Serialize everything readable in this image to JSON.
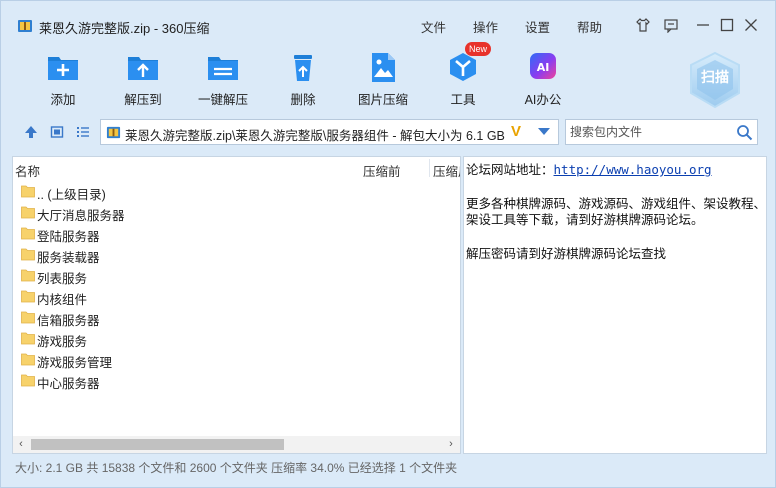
{
  "window": {
    "title": "莱恩久游完整版.zip - 360压缩",
    "menu": [
      "文件",
      "操作",
      "设置",
      "帮助"
    ]
  },
  "toolbar": {
    "items": [
      {
        "label": "添加",
        "icon": "add-icon"
      },
      {
        "label": "解压到",
        "icon": "extract-to-icon"
      },
      {
        "label": "一键解压",
        "icon": "one-click-extract-icon"
      },
      {
        "label": "删除",
        "icon": "trash-icon"
      },
      {
        "label": "图片压缩",
        "icon": "image-compress-icon"
      },
      {
        "label": "工具",
        "icon": "tools-icon"
      },
      {
        "label": "AI办公",
        "icon": "ai-office-icon"
      }
    ],
    "new_badge": "New",
    "scan_label": "扫描"
  },
  "address": {
    "path": "莱恩久游完整版.zip\\莱恩久游完整版\\服务器组件 - 解包大小为 6.1 GB",
    "v_mark": "V"
  },
  "search": {
    "placeholder": "搜索包内文件"
  },
  "file_list": {
    "columns": [
      "名称",
      "压缩前",
      "压缩后"
    ],
    "rows": [
      ".. (上级目录)",
      "大厅消息服务器",
      "登陆服务器",
      "服务装载器",
      "列表服务",
      "内核组件",
      "信箱服务器",
      "游戏服务",
      "游戏服务管理",
      "中心服务器"
    ]
  },
  "comment": {
    "line1_label": "论坛网站地址：",
    "line1_link": "http://www.haoyou.org",
    "line2": "更多各种棋牌源码、游戏源码、游戏组件、架设教程、",
    "line3": "架设工具等下载，请到好游棋牌源码论坛。",
    "line4": "解压密码请到好游棋牌源码论坛查找"
  },
  "status": "大小: 2.1 GB 共 15838 个文件和 2600 个文件夹 压缩率 34.0% 已经选择 1 个文件夹",
  "colors": {
    "accent": "#1e7fd8",
    "chrome": "#dbeaf8",
    "badge": "#e8322b"
  }
}
